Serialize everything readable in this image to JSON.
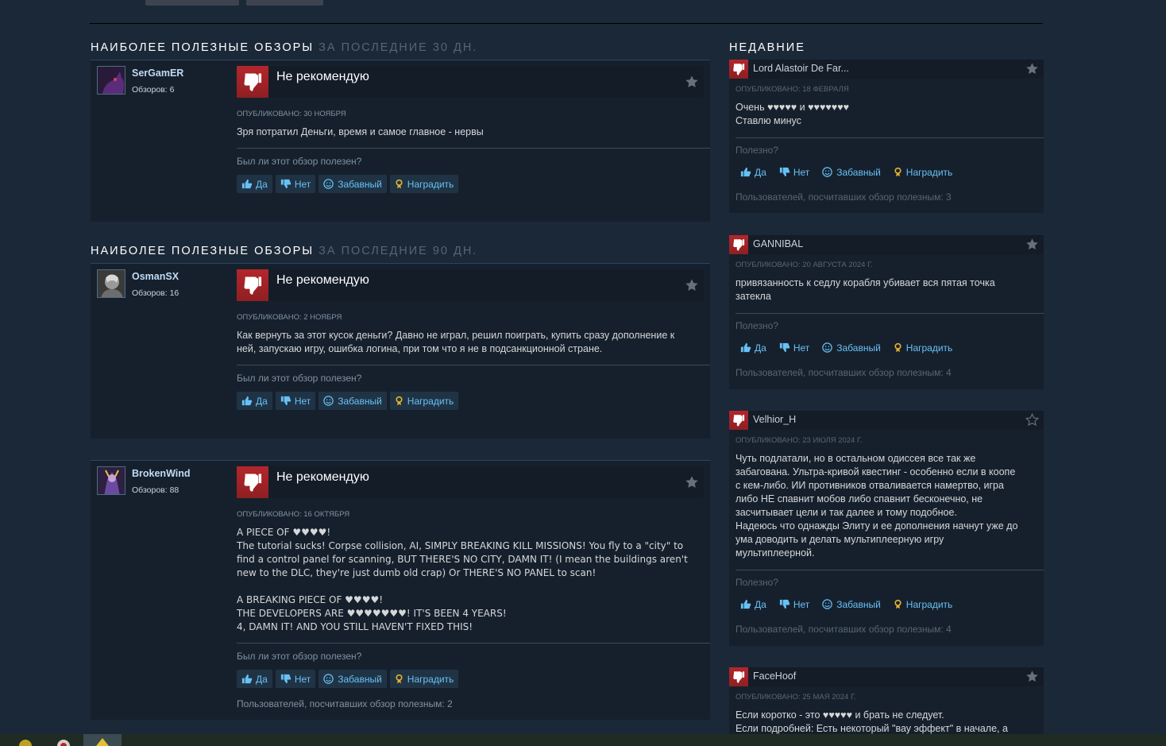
{
  "sections": [
    {
      "title": "Наиболее полезные обзоры",
      "subtitle": "за последние 30 дн."
    },
    {
      "title": "Наиболее полезные обзоры",
      "subtitle": "за последние 90 дн."
    }
  ],
  "reviews": [
    {
      "author": "SerGamER",
      "review_count": "Обзоров: 6",
      "verdict": "Не рекомендую",
      "posted": "Опубликовано: 30 ноября",
      "text": "Зря потратил Деньги, время и самое главное - нервы",
      "helpful_question": "Был ли этот обзор полезен?",
      "helpful_count": ""
    },
    {
      "author": "OsmanSX",
      "review_count": "Обзоров: 16",
      "verdict": "Не рекомендую",
      "posted": "Опубликовано: 2 ноября",
      "text": "Как вернуть за этот кусок деньги? Давно не играл, решил поиграть, купить сразу дополнение к\nней, запускаю игру, ошибка логина, при том что я не в подсанкционной стране.",
      "helpful_question": "Был ли этот обзор полезен?",
      "helpful_count": ""
    },
    {
      "author": "BrokenWind",
      "review_count": "Обзоров: 88",
      "verdict": "Не рекомендую",
      "posted": "Опубликовано: 16 октября",
      "text": "A PIECE OF ♥♥♥♥!\nThe tutorial sucks! Corpse collision, AI, SIMPLY BREAKING KILL MISSIONS! You fly to a \"city\" to\nfind a control panel for scanning, BUT THERE'S NO CITY, DAMN IT! (I mean the buildings aren't\nnew to the DLC, they're just dumb old crap) Or THERE'S NO PANEL to scan!\n\nA BREAKING PIECE OF ♥♥♥♥!\nTHE DEVELOPERS ARE ♥♥♥♥♥♥♥! IT'S BEEN 4 YEARS!\n4, DAMN IT! AND YOU STILL HAVEN'T FIXED THIS!",
      "helpful_question": "Был ли этот обзор полезен?",
      "helpful_count": "Пользователей, посчитавших обзор полезным: 2"
    }
  ],
  "vote_labels": {
    "yes": "Да",
    "no": "Нет",
    "funny": "Забавный",
    "award": "Наградить"
  },
  "recent": {
    "title": "Недавние",
    "items": [
      {
        "author": "Lord Alastoir De Far...",
        "posted": "Опубликовано: 18 февраля",
        "text": "Очень ♥♥♥♥♥ и ♥♥♥♥♥♥♥\nСтавлю минус",
        "question": "Полезно?",
        "helpful_count": "Пользователей, посчитавших обзор полезным: 3",
        "starred": true
      },
      {
        "author": "GANNIBAL",
        "posted": "Опубликовано: 20 августа 2024 г.",
        "text": "привязанность к седлу корабля убивает вся пятая точка\nзатекла",
        "question": "Полезно?",
        "helpful_count": "Пользователей, посчитавших обзор полезным: 4",
        "starred": true
      },
      {
        "author": "Velhior_H",
        "posted": "Опубликовано: 23 июля 2024 г.",
        "text": "Чуть подлатали, но в остальном одиссея все так же\nзабагована. Ультра-кривой квестинг - особенно если в коопе\nс кем-либо. ИИ противников отваливается намертво, игра\nлибо НЕ спавнит мобов либо спавнит бесконечно, не\nзасчитывает цели и так далее и тому подобное.\nНадеюсь что однажды Элиту и ее дополнения начнут уже до\nума доводить и делать мультиплеерную игру\nмультиплеерной.",
        "question": "Полезно?",
        "helpful_count": "Пользователей, посчитавших обзор полезным: 4",
        "starred": false
      },
      {
        "author": "FaceHoof",
        "posted": "Опубликовано: 25 мая 2024 г.",
        "text": "Если коротко - это ♥♥♥♥♥ и брать не следует.\nЕсли подробней: Есть некоторый \"вау эффект\" в начале, а",
        "question": "",
        "helpful_count": "",
        "starred": true
      }
    ]
  },
  "colors": {
    "background": "#1b2838",
    "thumb_down": "#b3262b",
    "link": "#67c1f5",
    "award": "#e5b22b"
  }
}
